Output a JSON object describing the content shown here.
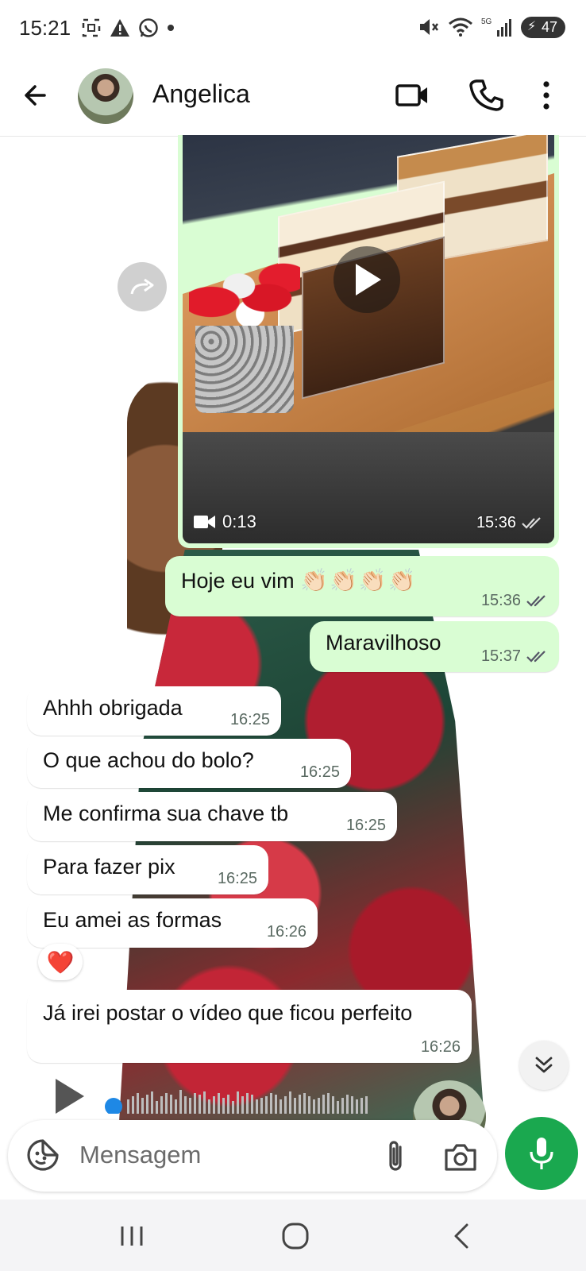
{
  "status_bar": {
    "time": "15:21",
    "battery": "47"
  },
  "header": {
    "contact_name": "Angelica",
    "icons": [
      "back-arrow-icon",
      "video-call-icon",
      "phone-icon",
      "more-vert-icon"
    ]
  },
  "video_message": {
    "duration": "0:13",
    "time": "15:36",
    "status": "delivered"
  },
  "messages": [
    {
      "direction": "out",
      "text": "Hoje eu vim",
      "emoji": "👏🏻👏🏻👏🏻👏🏻",
      "time": "15:36"
    },
    {
      "direction": "out",
      "text": "Maravilhoso",
      "time": "15:37"
    },
    {
      "direction": "in",
      "text": "Ahhh obrigada",
      "time": "16:25"
    },
    {
      "direction": "in",
      "text": "O que achou do bolo?",
      "time": "16:25"
    },
    {
      "direction": "in",
      "text": "Me confirma sua chave tb",
      "time": "16:25"
    },
    {
      "direction": "in",
      "text": "Para fazer pix",
      "time": "16:25"
    },
    {
      "direction": "in",
      "text": "Eu amei as formas",
      "time": "16:26",
      "reaction": "❤️"
    },
    {
      "direction": "in",
      "text": "Já irei postar o vídeo que ficou perfeito",
      "time": "16:26"
    }
  ],
  "composer": {
    "placeholder": "Mensagem"
  },
  "colors": {
    "outgoing_bubble": "#d9fdd3",
    "incoming_bubble": "#ffffff",
    "accent_green": "#1aa84f",
    "audio_progress": "#1e88e5"
  }
}
